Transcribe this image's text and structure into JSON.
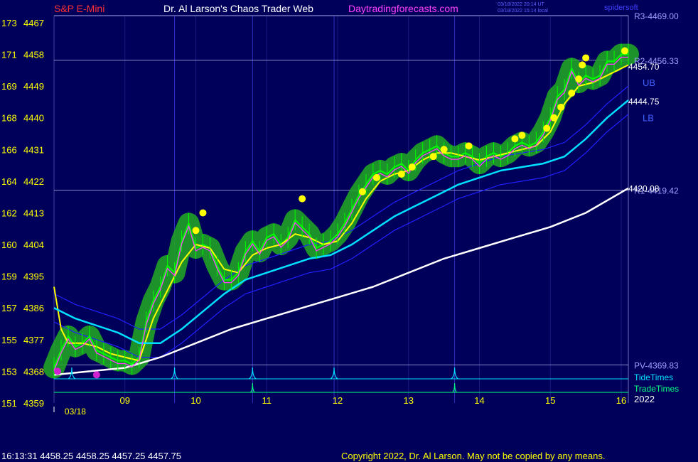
{
  "header": {
    "symbol": "S&P E-Mini",
    "site": "Dr. Al Larson's Chaos Trader Web",
    "url": "Daytradingforecasts.com",
    "stamp1": "03/18/2022 20:14 UT",
    "stamp2": "03/18/2022 15:14 local",
    "tag": "spidersoft"
  },
  "footer": {
    "quote": "16:13:31  4458.25 4458.25 4457.25 4457.75",
    "copyright": "Copyright 2022, Dr. Al Larson. May not be copied by any means."
  },
  "colors": {
    "background": "#00005a",
    "price": "#00ff00",
    "cloud": "#22aa22",
    "fast_avg": "#ffff00",
    "mid_avg": "#ff40ff",
    "slow_avg": "#00e0ff",
    "pivot_avg": "#ffffff",
    "band": "#2020ff",
    "tide": "#00e0ff",
    "trade": "#00ff80",
    "label_text": "#ffff00",
    "right_label": "#a0a0ff"
  },
  "chart_data": {
    "type": "line",
    "title": "S&P E-Mini",
    "y_left_labels": [
      {
        "cycle": "173",
        "price": 4467
      },
      {
        "cycle": "171",
        "price": 4458
      },
      {
        "cycle": "169",
        "price": 4449
      },
      {
        "cycle": "168",
        "price": 4440
      },
      {
        "cycle": "166",
        "price": 4431
      },
      {
        "cycle": "164",
        "price": 4422
      },
      {
        "cycle": "162",
        "price": 4413
      },
      {
        "cycle": "160",
        "price": 4404
      },
      {
        "cycle": "159",
        "price": 4395
      },
      {
        "cycle": "157",
        "price": 4386
      },
      {
        "cycle": "155",
        "price": 4377
      },
      {
        "cycle": "153",
        "price": 4368
      },
      {
        "cycle": "151",
        "price": 4359
      }
    ],
    "ylim": [
      4359,
      4469
    ],
    "xlim": [
      8.0,
      16.1
    ],
    "x_ticks": [
      "09",
      "10",
      "11",
      "12",
      "13",
      "14",
      "15",
      "16"
    ],
    "x_tick_values": [
      9,
      10,
      11,
      12,
      13,
      14,
      15,
      16
    ],
    "date_label": "03/18",
    "year_label": "2022",
    "levels": [
      {
        "label": "R3-4469.00",
        "value": 4469.0
      },
      {
        "label": "R2-4456.33",
        "value": 4456.33
      },
      {
        "label": "R1-4419.42",
        "value": 4419.42
      },
      {
        "label": "PV-4369.83",
        "value": 4369.83
      }
    ],
    "value_labels": [
      {
        "label": "4454.70",
        "value": 4454.7
      },
      {
        "label": "4444.75",
        "value": 4444.75
      },
      {
        "label": "4420.08",
        "value": 4420.08
      }
    ],
    "band_labels": [
      {
        "label": "UB",
        "value": 4450
      },
      {
        "label": "LB",
        "value": 4440
      }
    ],
    "lane_labels": [
      "TideTimes",
      "TradeTimes"
    ],
    "vertical_markers": [
      9.7,
      10.8,
      11.95,
      13.65
    ],
    "tide_spikes": [
      8.25,
      9.7,
      10.8,
      11.95,
      13.65
    ],
    "trade_spikes": [
      10.8,
      13.65
    ],
    "series": [
      {
        "name": "Price",
        "x": [
          8.0,
          8.1,
          8.2,
          8.3,
          8.4,
          8.5,
          8.6,
          8.7,
          8.8,
          8.9,
          9.0,
          9.1,
          9.2,
          9.3,
          9.4,
          9.5,
          9.6,
          9.7,
          9.8,
          9.9,
          10.0,
          10.1,
          10.2,
          10.3,
          10.4,
          10.5,
          10.6,
          10.7,
          10.8,
          10.9,
          11.0,
          11.1,
          11.2,
          11.3,
          11.4,
          11.5,
          11.6,
          11.7,
          11.8,
          11.9,
          12.0,
          12.1,
          12.2,
          12.3,
          12.4,
          12.5,
          12.6,
          12.7,
          12.8,
          12.9,
          13.0,
          13.1,
          13.2,
          13.3,
          13.4,
          13.5,
          13.6,
          13.7,
          13.8,
          13.9,
          14.0,
          14.1,
          14.2,
          14.3,
          14.4,
          14.5,
          14.6,
          14.7,
          14.8,
          14.9,
          15.0,
          15.1,
          15.2,
          15.3,
          15.4,
          15.5,
          15.6,
          15.7,
          15.8,
          15.9,
          16.0,
          16.1
        ],
        "values": [
          4369,
          4374,
          4378,
          4375,
          4376,
          4378,
          4374,
          4373,
          4372,
          4371,
          4371,
          4370,
          4372,
          4382,
          4388,
          4392,
          4398,
          4396,
          4405,
          4410,
          4403,
          4404,
          4403,
          4398,
          4394,
          4394,
          4396,
          4402,
          4405,
          4402,
          4406,
          4407,
          4404,
          4406,
          4411,
          4409,
          4407,
          4403,
          4404,
          4405,
          4407,
          4410,
          4414,
          4418,
          4421,
          4424,
          4425,
          4424,
          4426,
          4427,
          4425,
          4428,
          4430,
          4431,
          4432,
          4430,
          4429,
          4429,
          4430,
          4429,
          4427,
          4429,
          4430,
          4429,
          4430,
          4432,
          4433,
          4432,
          4433,
          4436,
          4440,
          4446,
          4448,
          4454,
          4450,
          4452,
          4451,
          4452,
          4456,
          4456,
          4458,
          4458
        ]
      },
      {
        "name": "Fast Avg",
        "x": [
          8.0,
          8.1,
          8.2,
          8.4,
          8.6,
          8.8,
          9.0,
          9.2,
          9.4,
          9.6,
          9.8,
          10.0,
          10.2,
          10.4,
          10.6,
          10.8,
          11.0,
          11.2,
          11.4,
          11.6,
          11.8,
          12.0,
          12.2,
          12.4,
          12.6,
          12.8,
          13.0,
          13.2,
          13.4,
          13.6,
          13.8,
          14.0,
          14.2,
          14.4,
          14.6,
          14.8,
          15.0,
          15.2,
          15.4,
          15.6,
          15.8,
          16.0,
          16.1
        ],
        "values": [
          4392,
          4380,
          4376,
          4376,
          4375,
          4373,
          4372,
          4371,
          4383,
          4391,
          4399,
          4404,
          4403,
          4397,
          4396,
          4401,
          4403,
          4404,
          4407,
          4406,
          4404,
          4405,
          4410,
          4417,
          4422,
          4424,
          4425,
          4428,
          4430,
          4430,
          4429,
          4428,
          4429,
          4430,
          4431,
          4432,
          4436,
          4444,
          4449,
          4450,
          4452,
          4454,
          4455
        ]
      },
      {
        "name": "Slow Avg",
        "x": [
          8.0,
          8.3,
          8.6,
          8.9,
          9.2,
          9.5,
          9.8,
          10.1,
          10.4,
          10.7,
          11.0,
          11.3,
          11.6,
          11.9,
          12.2,
          12.5,
          12.8,
          13.1,
          13.4,
          13.7,
          14.0,
          14.3,
          14.6,
          14.9,
          15.2,
          15.5,
          15.8,
          16.1
        ],
        "values": [
          4386,
          4383,
          4381,
          4379,
          4376,
          4376,
          4380,
          4385,
          4390,
          4394,
          4396,
          4398,
          4400,
          4401,
          4404,
          4408,
          4412,
          4415,
          4418,
          4421,
          4423,
          4425,
          4426,
          4427,
          4429,
          4434,
          4440,
          4445
        ]
      },
      {
        "name": "Pivot Avg",
        "x": [
          8.0,
          8.5,
          9.0,
          9.5,
          10.0,
          10.5,
          11.0,
          11.5,
          12.0,
          12.5,
          13.0,
          13.5,
          14.0,
          14.5,
          15.0,
          15.5,
          16.1
        ],
        "values": [
          4367,
          4368,
          4369,
          4372,
          4376,
          4380,
          4383,
          4386,
          4389,
          4392,
          4396,
          4400,
          4403,
          4406,
          4409,
          4413,
          4420
        ]
      }
    ],
    "highlight_points": [
      {
        "x": 10.0,
        "y": 4408
      },
      {
        "x": 10.1,
        "y": 4413
      },
      {
        "x": 11.5,
        "y": 4417
      },
      {
        "x": 12.35,
        "y": 4419
      },
      {
        "x": 12.55,
        "y": 4423
      },
      {
        "x": 12.9,
        "y": 4424
      },
      {
        "x": 13.05,
        "y": 4426
      },
      {
        "x": 13.35,
        "y": 4429
      },
      {
        "x": 13.5,
        "y": 4431
      },
      {
        "x": 13.85,
        "y": 4432
      },
      {
        "x": 14.5,
        "y": 4434
      },
      {
        "x": 14.6,
        "y": 4435
      },
      {
        "x": 14.95,
        "y": 4437
      },
      {
        "x": 15.05,
        "y": 4440
      },
      {
        "x": 15.15,
        "y": 4443
      },
      {
        "x": 15.3,
        "y": 4447
      },
      {
        "x": 15.4,
        "y": 4451
      },
      {
        "x": 15.45,
        "y": 4455
      },
      {
        "x": 15.5,
        "y": 4457
      },
      {
        "x": 16.05,
        "y": 4459
      }
    ],
    "low_points": [
      {
        "x": 8.05,
        "y": 4368
      },
      {
        "x": 8.6,
        "y": 4367
      }
    ]
  }
}
